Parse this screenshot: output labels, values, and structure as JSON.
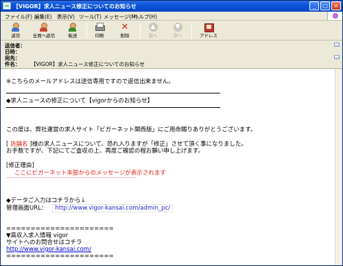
{
  "window": {
    "title": "【VIGOR】求人ニュース修正についてのお知らせ",
    "buttons": {
      "minimize": "_",
      "maximize": "□",
      "close": "×"
    }
  },
  "menu": [
    "ファイル(F)",
    "編集(E)",
    "表示(V)",
    "ツール(T)",
    "メッセージ(M)",
    "ヘルプ(H)"
  ],
  "toolbar": [
    {
      "label": "返信",
      "icon": "reply-icon",
      "enabled": true
    },
    {
      "label": "全員へ返信",
      "icon": "reply-all-icon",
      "enabled": true
    },
    {
      "label": "転送",
      "icon": "forward-icon",
      "enabled": true
    },
    {
      "label": "印刷",
      "icon": "printer-icon",
      "enabled": true
    },
    {
      "label": "削除",
      "icon": "delete-icon",
      "enabled": true
    },
    {
      "label": "前へ",
      "icon": "previous-icon",
      "enabled": false
    },
    {
      "label": "次へ",
      "icon": "next-icon",
      "enabled": false
    },
    {
      "label": "アドレス",
      "icon": "address-book-icon",
      "enabled": true
    }
  ],
  "headers": {
    "from_label": "送信者：",
    "from_value": "",
    "date_label": "日時：",
    "date_value": "",
    "to_label": "宛先：",
    "to_value": "",
    "subject_label": "件名：",
    "subject_value": "【VIGOR】求人ニュース修正についてのお知らせ"
  },
  "body": {
    "notice": "※こちらのメールアドレスは送信専用ですので返信出来ません。",
    "heading": "◆求人ニュースの修正について【vigorからのお知らせ】",
    "para1": "この度は、弊社運営の求人サイト「ビガーネット関西版」にご用命賜りありがとうございます。",
    "para2_pre": "[ ",
    "para2_store": "店舗名",
    "para2_post": " ]様の求人ニュースについて、恐れ入りますが「修正」させて頂く事になりました。",
    "para3": "お手数ですが、下記にてご査収の上、再度ご確認の程お願い申し上げます。",
    "reason_label": "[修正理由]",
    "reason_text": "ここにビガーネット本部からのメッセージが表示されます",
    "reason_underline": "＿＿＿＿＿＿＿＿＿＿＿＿＿＿＿＿＿＿＿＿＿＿＿＿＿＿＿",
    "data_entry": "◆データご入力はコチラから↓",
    "admin_label": "管理画面URL：",
    "admin_url": "http://www.vigor-kansai.com/admin_pc/",
    "divider": "======================",
    "footer_title": "▼高収入求人情報 vigor",
    "footer_contact": "サイトへのお問合せはコチラ",
    "footer_url": "http://www.vigor-kansai.com/",
    "divider2": "======================"
  }
}
